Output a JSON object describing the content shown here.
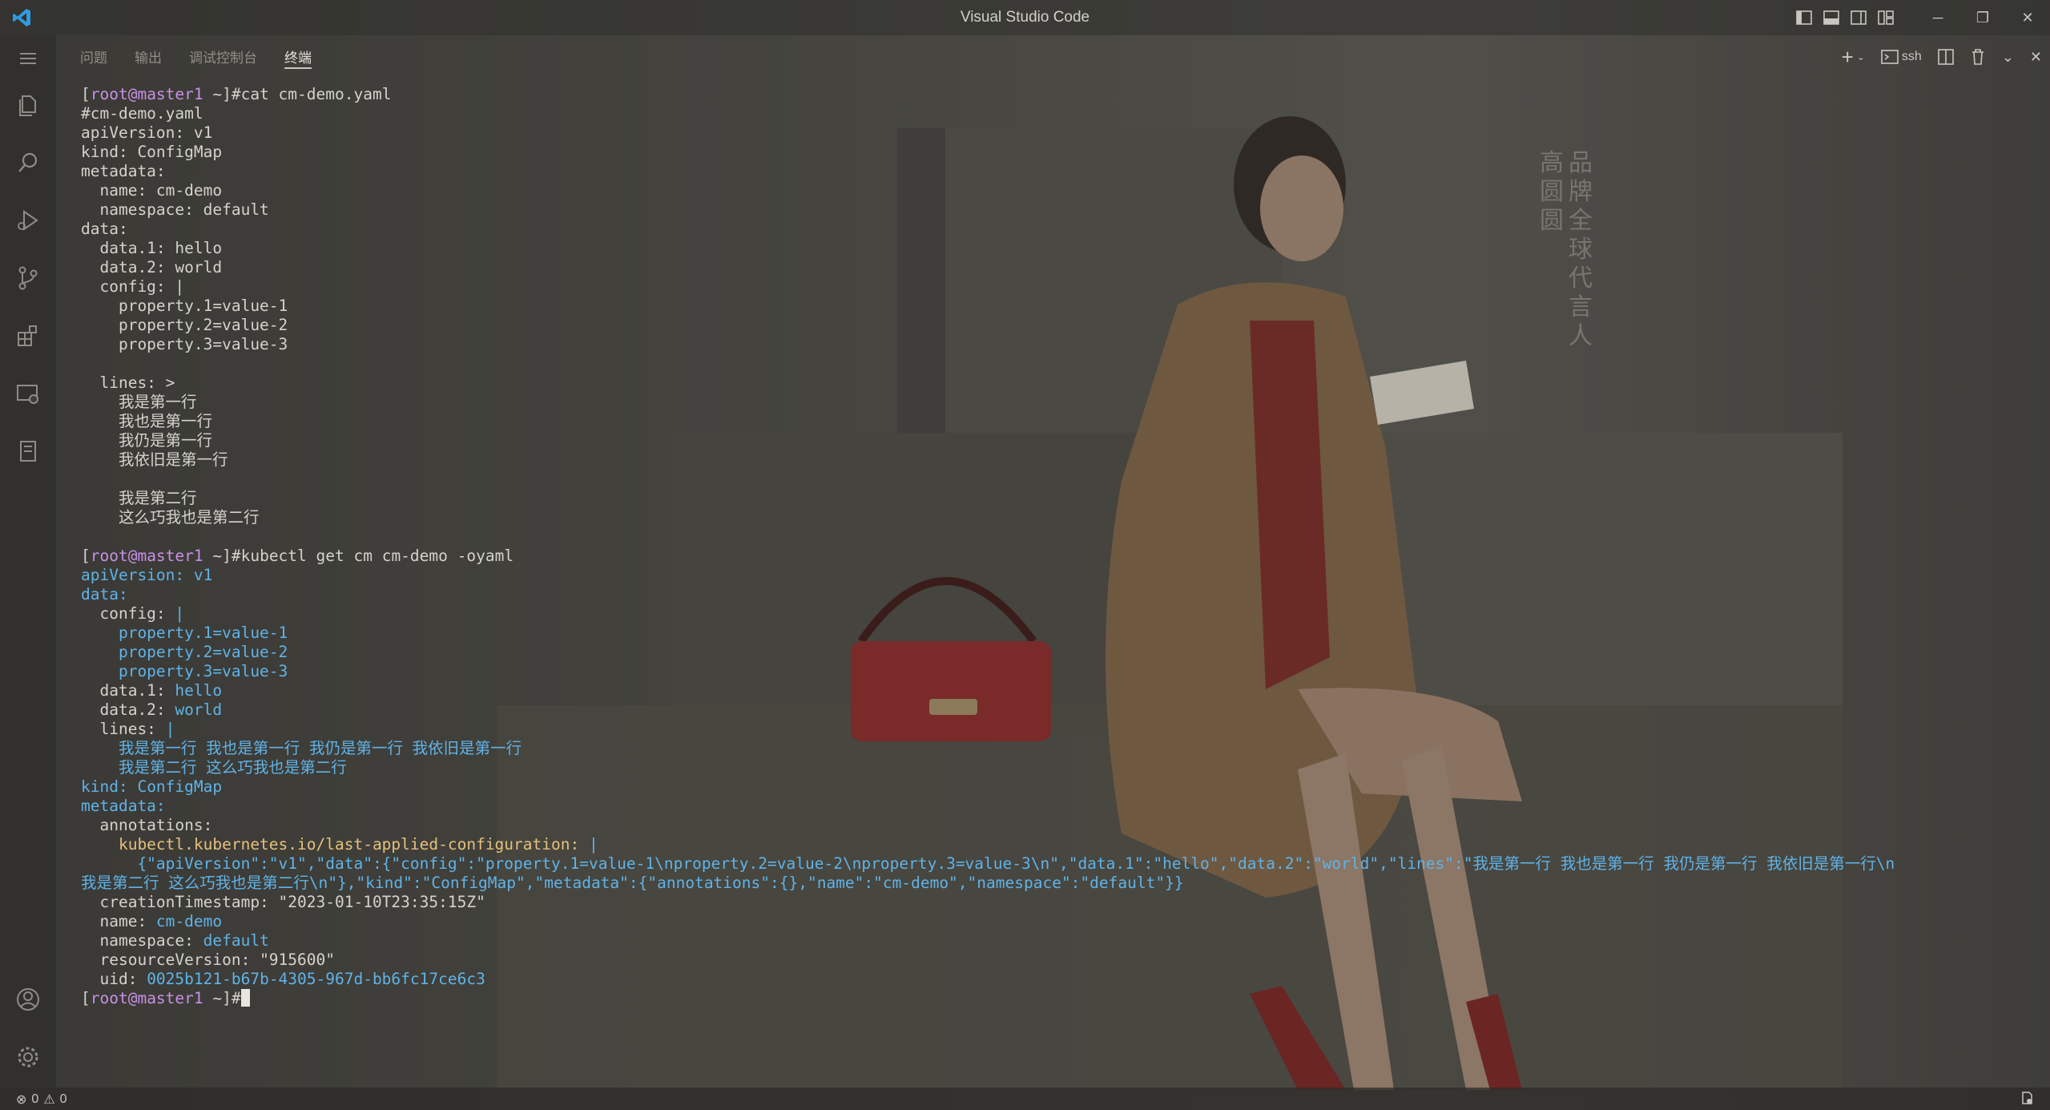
{
  "window": {
    "title": "Visual Studio Code"
  },
  "titlebar_icons": [
    "toggle-primary-sidebar-icon",
    "toggle-panel-icon",
    "toggle-secondary-sidebar-icon",
    "customize-layout-icon"
  ],
  "window_controls": {
    "minimize": "─",
    "restore": "❐",
    "close": "✕"
  },
  "activity_bar": [
    "menu-icon",
    "explorer-icon",
    "search-icon",
    "run-debug-icon",
    "source-control-icon",
    "extensions-icon",
    "remote-explorer-icon",
    "notebook-icon",
    "account-icon",
    "settings-gear-icon"
  ],
  "panel": {
    "tabs": [
      "问题",
      "输出",
      "调试控制台",
      "终端"
    ],
    "active_tab": "终端",
    "actions": {
      "new_terminal": "+",
      "terminal_profile_label": "ssh"
    }
  },
  "background_text": {
    "col1": "品牌全球代言人",
    "col2": "高圆圆"
  },
  "terminal": {
    "lines": [
      [
        {
          "t": "[",
          "c": "b"
        },
        {
          "t": "root@master1",
          "c": "u"
        },
        {
          "t": " ~]#cat cm-demo.yaml",
          "c": "b"
        }
      ],
      [
        {
          "t": "#cm-demo.yaml",
          "c": "k"
        }
      ],
      [
        {
          "t": "apiVersion: v1",
          "c": "k"
        }
      ],
      [
        {
          "t": "kind: ConfigMap",
          "c": "k"
        }
      ],
      [
        {
          "t": "metadata:",
          "c": "k"
        }
      ],
      [
        {
          "t": "  name: cm-demo",
          "c": "k"
        }
      ],
      [
        {
          "t": "  namespace: default",
          "c": "k"
        }
      ],
      [
        {
          "t": "data:",
          "c": "k"
        }
      ],
      [
        {
          "t": "  data.1: hello",
          "c": "k"
        }
      ],
      [
        {
          "t": "  data.2: world",
          "c": "k"
        }
      ],
      [
        {
          "t": "  config: |",
          "c": "k"
        }
      ],
      [
        {
          "t": "    property.1=value-1",
          "c": "k"
        }
      ],
      [
        {
          "t": "    property.2=value-2",
          "c": "k"
        }
      ],
      [
        {
          "t": "    property.3=value-3",
          "c": "k"
        }
      ],
      [
        {
          "t": "",
          "c": "k"
        }
      ],
      [
        {
          "t": "  lines: >",
          "c": "k"
        }
      ],
      [
        {
          "t": "    我是第一行",
          "c": "k"
        }
      ],
      [
        {
          "t": "    我也是第一行",
          "c": "k"
        }
      ],
      [
        {
          "t": "    我仍是第一行",
          "c": "k"
        }
      ],
      [
        {
          "t": "    我依旧是第一行",
          "c": "k"
        }
      ],
      [
        {
          "t": "",
          "c": "k"
        }
      ],
      [
        {
          "t": "    我是第二行",
          "c": "k"
        }
      ],
      [
        {
          "t": "    这么巧我也是第二行",
          "c": "k"
        }
      ],
      [
        {
          "t": "",
          "c": "k"
        }
      ],
      [
        {
          "t": "[",
          "c": "b"
        },
        {
          "t": "root@master1",
          "c": "u"
        },
        {
          "t": " ~]#kubectl get cm cm-demo -oyaml",
          "c": "b"
        }
      ],
      [
        {
          "t": "apiVersion: ",
          "c": "v"
        },
        {
          "t": "v1",
          "c": "v"
        }
      ],
      [
        {
          "t": "data:",
          "c": "v"
        }
      ],
      [
        {
          "t": "  config: ",
          "c": "k"
        },
        {
          "t": "|",
          "c": "v"
        }
      ],
      [
        {
          "t": "    property.1=value-1",
          "c": "v"
        }
      ],
      [
        {
          "t": "    property.2=value-2",
          "c": "v"
        }
      ],
      [
        {
          "t": "    property.3=value-3",
          "c": "v"
        }
      ],
      [
        {
          "t": "  data.1: ",
          "c": "k"
        },
        {
          "t": "hello",
          "c": "v"
        }
      ],
      [
        {
          "t": "  data.2: ",
          "c": "k"
        },
        {
          "t": "world",
          "c": "v"
        }
      ],
      [
        {
          "t": "  lines: ",
          "c": "k"
        },
        {
          "t": "|",
          "c": "v"
        }
      ],
      [
        {
          "t": "    我是第一行 我也是第一行 我仍是第一行 我依旧是第一行",
          "c": "v"
        }
      ],
      [
        {
          "t": "    我是第二行 这么巧我也是第二行",
          "c": "v"
        }
      ],
      [
        {
          "t": "kind: ",
          "c": "v"
        },
        {
          "t": "ConfigMap",
          "c": "v"
        }
      ],
      [
        {
          "t": "metadata:",
          "c": "v"
        }
      ],
      [
        {
          "t": "  annotations:",
          "c": "k"
        }
      ],
      [
        {
          "t": "    kubectl.kubernetes.io/last-applied-configuration: ",
          "c": "a"
        },
        {
          "t": "|",
          "c": "v"
        }
      ],
      [
        {
          "t": "      {\"apiVersion\":\"v1\",\"data\":{\"config\":\"property.1=value-1\\nproperty.2=value-2\\nproperty.3=value-3\\n\",\"data.1\":\"hello\",\"data.2\":\"world\",\"lines\":\"我是第一行 我也是第一行 我仍是第一行 我依旧是第一行\\n",
          "c": "v"
        }
      ],
      [
        {
          "t": "我是第二行 这么巧我也是第二行\\n\"},\"kind\":\"ConfigMap\",\"metadata\":{\"annotations\":{},\"name\":\"cm-demo\",\"namespace\":\"default\"}}",
          "c": "v"
        }
      ],
      [
        {
          "t": "  creationTimestamp: ",
          "c": "k"
        },
        {
          "t": "\"2023-01-10T23:35:15Z\"",
          "c": "k"
        }
      ],
      [
        {
          "t": "  name: ",
          "c": "k"
        },
        {
          "t": "cm-demo",
          "c": "v"
        }
      ],
      [
        {
          "t": "  namespace: ",
          "c": "k"
        },
        {
          "t": "default",
          "c": "v"
        }
      ],
      [
        {
          "t": "  resourceVersion: ",
          "c": "k"
        },
        {
          "t": "\"915600\"",
          "c": "k"
        }
      ],
      [
        {
          "t": "  uid: ",
          "c": "k"
        },
        {
          "t": "0025b121-b67b-4305-967d-bb6fc17ce6c3",
          "c": "v"
        }
      ],
      [
        {
          "t": "[",
          "c": "b"
        },
        {
          "t": "root@master1",
          "c": "u"
        },
        {
          "t": " ~]#",
          "c": "b"
        },
        {
          "t": "",
          "c": "cursor"
        }
      ]
    ]
  },
  "status_bar": {
    "errors": "0",
    "warnings": "0"
  },
  "colors": {
    "prompt_user": "#c790e6",
    "yaml_value": "#5fb3e8",
    "annotation_key": "#e5c07b",
    "foreground": "#d4d2cd"
  }
}
